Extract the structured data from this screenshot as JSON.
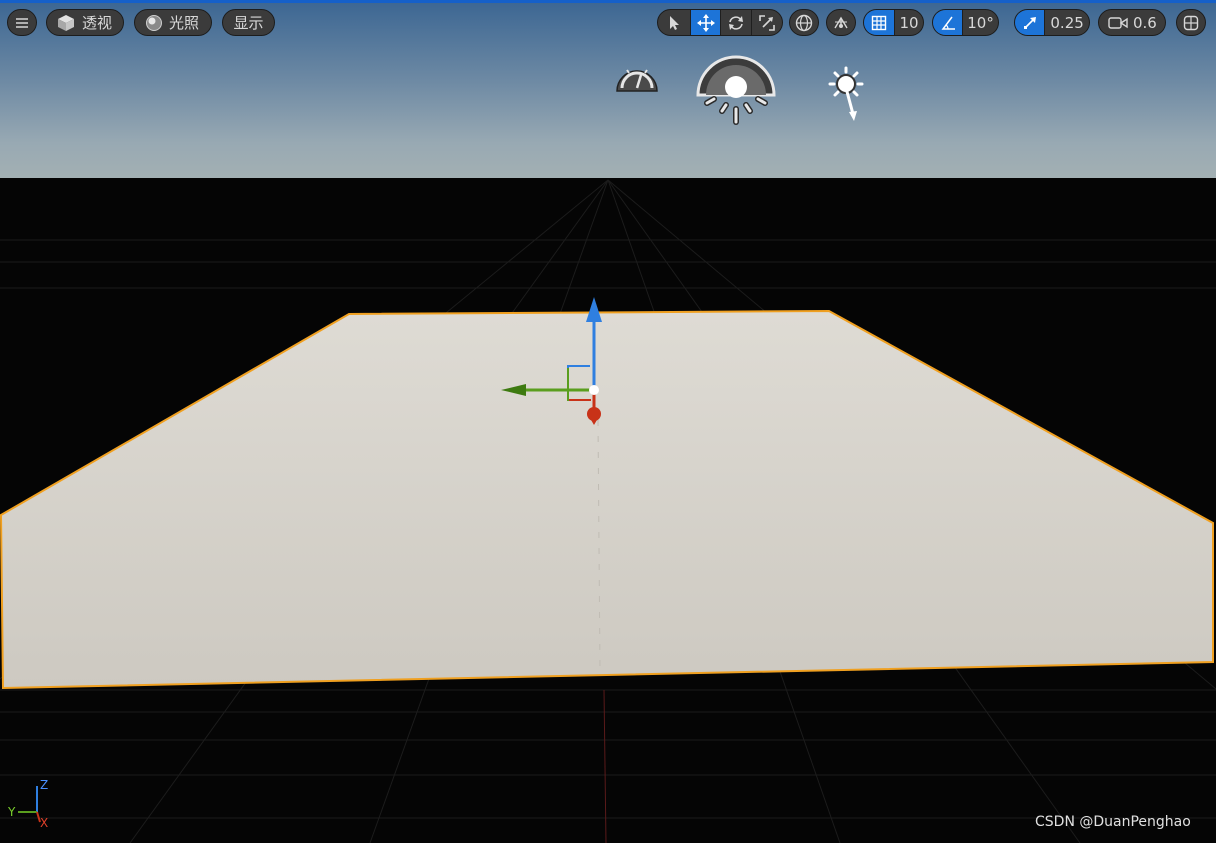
{
  "toolbar": {
    "menu_icon": "hamburger-menu-icon",
    "view_mode_label": "透视",
    "lighting_label": "光照",
    "show_label": "显示",
    "grid_snap_value": "10",
    "rotation_snap_value": "10°",
    "scale_snap_value": "0.25",
    "camera_speed_value": "0.6",
    "active_tool": "move",
    "accent_color": "#1d74d8"
  },
  "scene_icons": [
    "sky-atmosphere-icon",
    "skylight-icon",
    "directional-light-icon"
  ],
  "axis_indicator": {
    "z": "Z",
    "y": "Y",
    "x": "X"
  },
  "watermark": "CSDN @DuanPenghao",
  "colors": {
    "x_axis": "#c83218",
    "y_axis": "#5a9e1e",
    "z_axis": "#2f7fe0",
    "selection_outline": "#f0a020"
  }
}
